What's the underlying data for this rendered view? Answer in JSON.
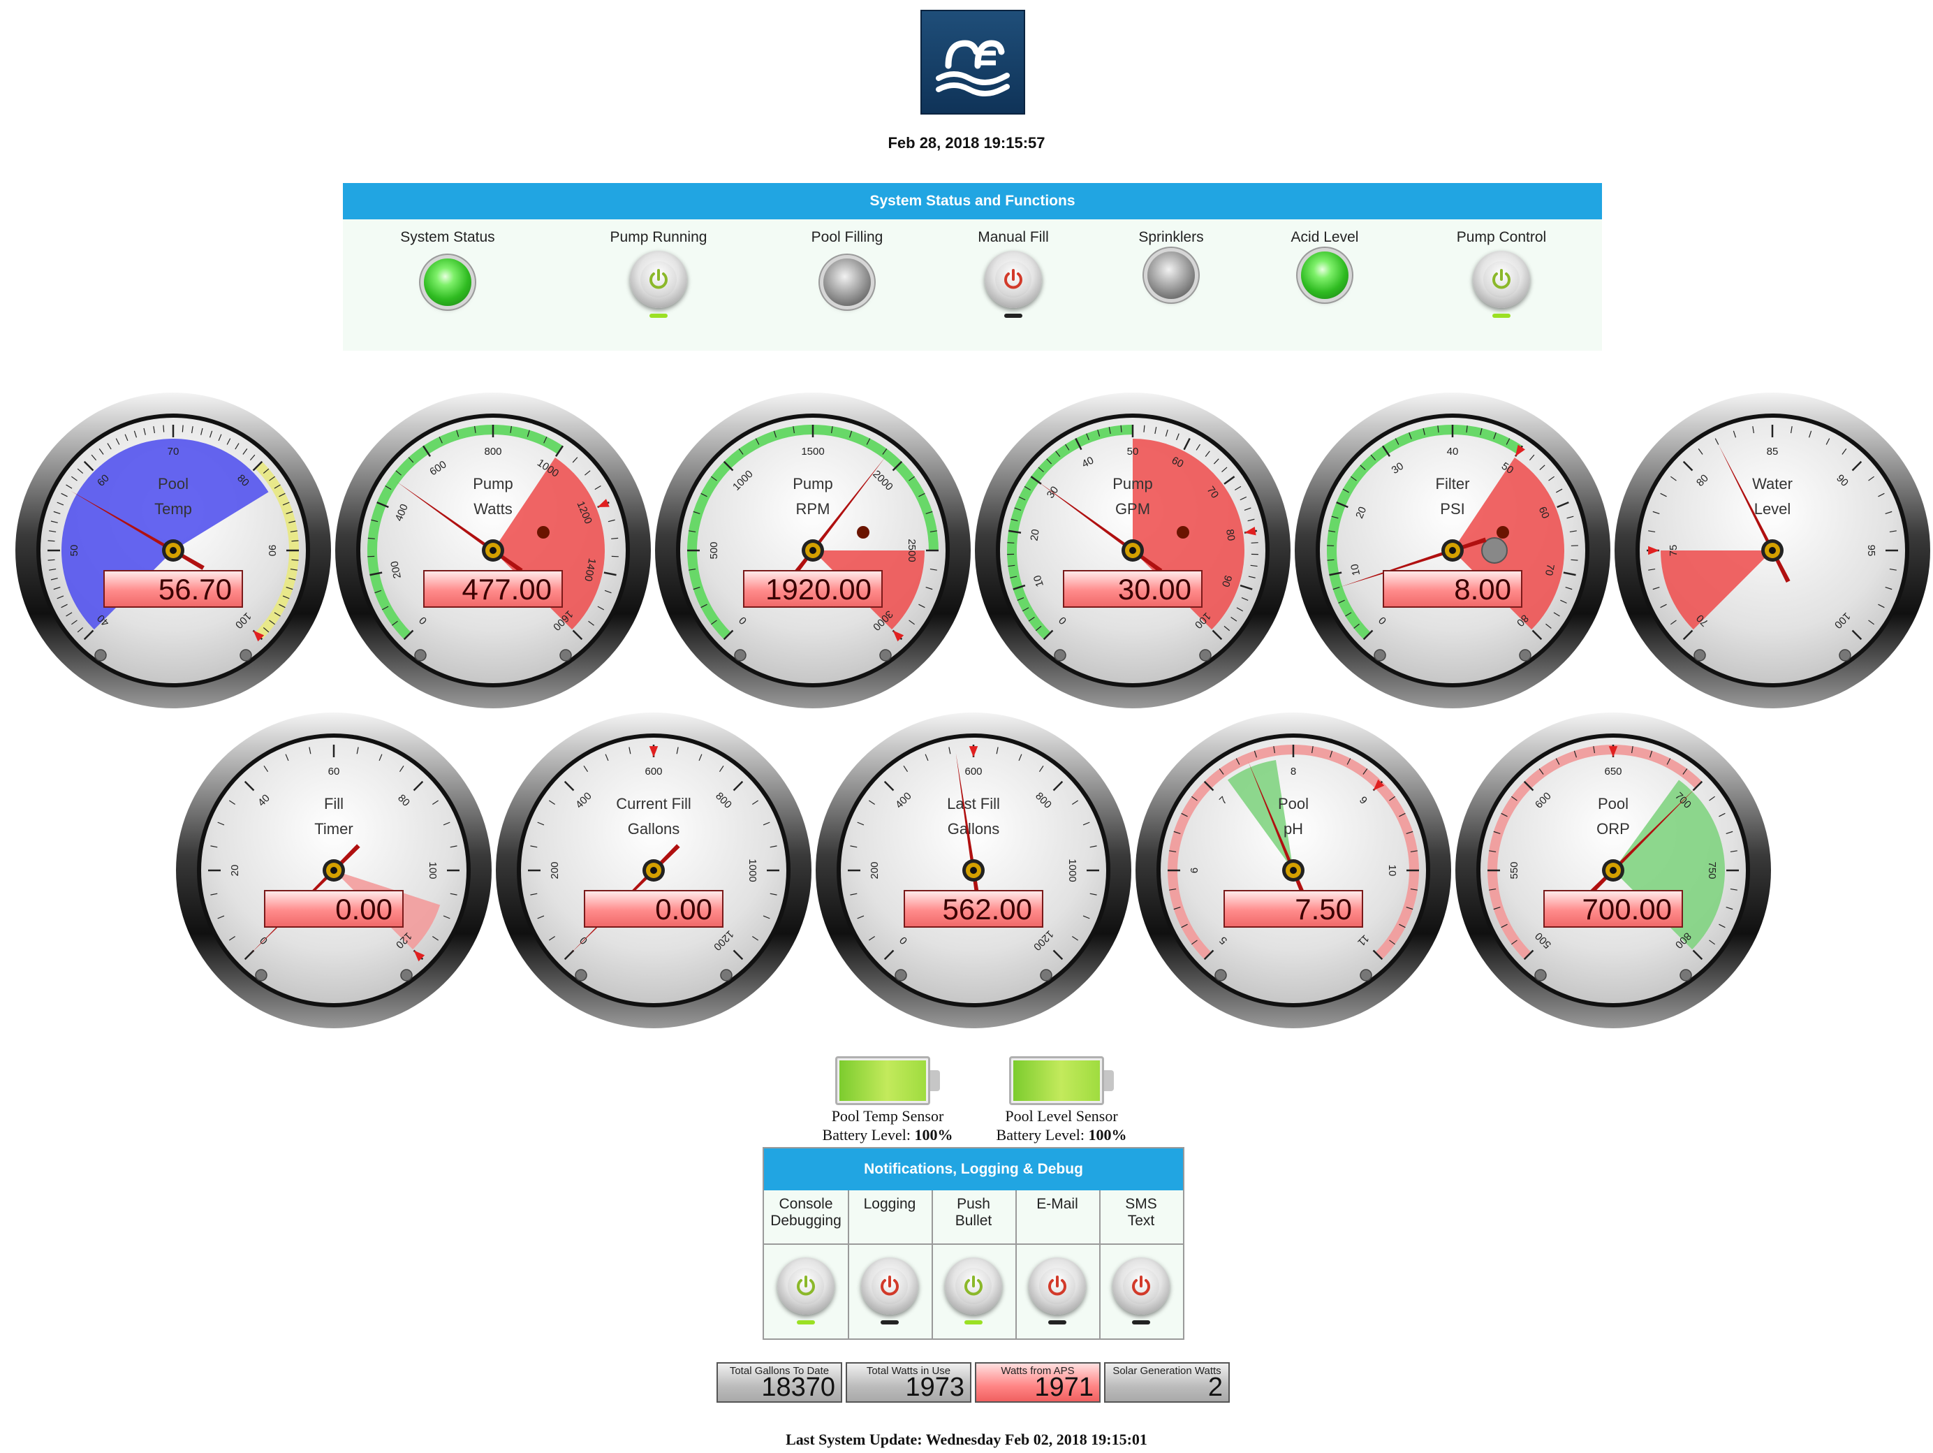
{
  "header": {
    "timestamp": "Feb 28, 2018 19:15:57"
  },
  "status_panel": {
    "title": "System Status and Functions",
    "items": [
      {
        "label": "System Status",
        "kind": "led",
        "state": "green"
      },
      {
        "label": "Pump Running",
        "kind": "power",
        "icon_color": "#8bb82a",
        "indicator": "on"
      },
      {
        "label": "Pool Filling",
        "kind": "led",
        "state": "gray"
      },
      {
        "label": "Manual Fill",
        "kind": "power",
        "icon_color": "#d23a2a",
        "indicator": "off"
      },
      {
        "label": "Sprinklers",
        "kind": "led",
        "state": "gray"
      },
      {
        "label": "Acid Level",
        "kind": "led",
        "state": "green"
      },
      {
        "label": "Pump Control",
        "kind": "power",
        "icon_color": "#8bb82a",
        "indicator": "on"
      }
    ]
  },
  "gauges": [
    {
      "id": "pool-temp",
      "title1": "Pool",
      "title2": "Temp",
      "min": 40,
      "max": 100,
      "major": 10,
      "minor": 1,
      "value": 56.7,
      "display": "56.70",
      "labels": [
        "40",
        "50",
        "60",
        "70",
        "80",
        "90",
        "100"
      ],
      "sections": [
        {
          "from": 40,
          "to": 83,
          "color": "#5050ee"
        }
      ],
      "bands": [
        {
          "from": 80,
          "to": 100,
          "color": "#e8e88a"
        }
      ],
      "marker": 100
    },
    {
      "id": "pump-watts",
      "title1": "Pump",
      "title2": "Watts",
      "min": 0,
      "max": 1600,
      "major": 200,
      "minor": 50,
      "value": 477,
      "display": "477.00",
      "labels": [
        "0",
        "200",
        "400",
        "600",
        "800",
        "1000",
        "1200",
        "1400",
        "1600"
      ],
      "sections": [
        {
          "from": 1000,
          "to": 1600,
          "color": "#ee5050"
        }
      ],
      "bands": [
        {
          "from": 0,
          "to": 1000,
          "color": "#68d868"
        }
      ],
      "marker": 1200,
      "led": true
    },
    {
      "id": "pump-rpm",
      "title1": "Pump",
      "title2": "RPM",
      "min": 0,
      "max": 3000,
      "major": 500,
      "minor": 100,
      "value": 1920,
      "display": "1920.00",
      "labels": [
        "0",
        "500",
        "1000",
        "1500",
        "2000",
        "2500",
        "3000"
      ],
      "sections": [
        {
          "from": 2500,
          "to": 3000,
          "color": "#ee5050"
        }
      ],
      "bands": [
        {
          "from": 0,
          "to": 2500,
          "color": "#68d868"
        }
      ],
      "marker": 3000,
      "led": true
    },
    {
      "id": "pump-gpm",
      "title1": "Pump",
      "title2": "GPM",
      "min": 0,
      "max": 100,
      "major": 10,
      "minor": 2,
      "value": 30,
      "display": "30.00",
      "labels": [
        "0",
        "10",
        "20",
        "30",
        "40",
        "50",
        "60",
        "70",
        "80",
        "90",
        "100"
      ],
      "sections": [
        {
          "from": 50,
          "to": 100,
          "color": "#ee5050"
        }
      ],
      "bands": [
        {
          "from": 0,
          "to": 50,
          "color": "#68d868"
        }
      ],
      "marker": 80,
      "led": true
    },
    {
      "id": "filter-psi",
      "title1": "Filter",
      "title2": "PSI",
      "min": 0,
      "max": 80,
      "major": 10,
      "minor": 2,
      "value": 8,
      "display": "8.00",
      "labels": [
        "0",
        "10",
        "20",
        "30",
        "40",
        "50",
        "60",
        "70",
        "80"
      ],
      "sections": [
        {
          "from": 50,
          "to": 80,
          "color": "#ee5050"
        }
      ],
      "bands": [
        {
          "from": 0,
          "to": 50,
          "color": "#68d868"
        }
      ],
      "marker": 50,
      "led": true,
      "knob": true
    },
    {
      "id": "water-level",
      "title1": "Water",
      "title2": "Level",
      "min": 70,
      "max": 100,
      "major": 5,
      "minor": 1,
      "value": 82,
      "display": "",
      "labels": [
        "70",
        "75",
        "80",
        "85",
        "90",
        "95",
        "100"
      ],
      "sections": [
        {
          "from": 70,
          "to": 75,
          "color": "#ee5050"
        }
      ],
      "bands": [],
      "marker": 75
    },
    {
      "id": "fill-timer",
      "title1": "Fill",
      "title2": "Timer",
      "min": 0,
      "max": 120,
      "major": 20,
      "minor": 5,
      "value": 0,
      "display": "0.00",
      "labels": [
        "0",
        "20",
        "40",
        "60",
        "80",
        "100",
        "120"
      ],
      "sections": [
        {
          "from": 108,
          "to": 120,
          "color": "#f39a9a"
        }
      ],
      "bands": [],
      "marker": 120
    },
    {
      "id": "current-fill",
      "title1": "Current Fill",
      "title2": "Gallons",
      "min": 0,
      "max": 1200,
      "major": 200,
      "minor": 50,
      "value": 0,
      "display": "0.00",
      "labels": [
        "0",
        "200",
        "400",
        "600",
        "800",
        "1000",
        "1200"
      ],
      "sections": [],
      "bands": [],
      "marker": 600
    },
    {
      "id": "last-fill",
      "title1": "Last Fill",
      "title2": "Gallons",
      "min": 0,
      "max": 1200,
      "major": 200,
      "minor": 50,
      "value": 562,
      "display": "562.00",
      "labels": [
        "0",
        "200",
        "400",
        "600",
        "800",
        "1000",
        "1200"
      ],
      "sections": [],
      "bands": [],
      "marker": 600
    },
    {
      "id": "pool-ph",
      "title1": "Pool",
      "title2": "pH",
      "min": 5,
      "max": 11,
      "major": 1,
      "minor": 0.2,
      "value": 7.5,
      "display": "7.50",
      "labels": [
        "5",
        "6",
        "7",
        "8",
        "9",
        "10",
        "11"
      ],
      "sections": [
        {
          "from": 7.2,
          "to": 7.8,
          "color": "#7ed37e"
        }
      ],
      "bands": [
        {
          "from": 5,
          "to": 11,
          "color": "#f0a0a0"
        }
      ],
      "marker": 9
    },
    {
      "id": "pool-orp",
      "title1": "Pool",
      "title2": "ORP",
      "min": 500,
      "max": 800,
      "major": 50,
      "minor": 10,
      "value": 700,
      "display": "700.00",
      "labels": [
        "500",
        "550",
        "600",
        "650",
        "700",
        "750",
        "800"
      ],
      "sections": [
        {
          "from": 690,
          "to": 800,
          "color": "#7ed37e"
        }
      ],
      "bands": [
        {
          "from": 500,
          "to": 700,
          "color": "#f0a0a0"
        }
      ],
      "marker": 650
    }
  ],
  "batteries": [
    {
      "label": "Pool Temp Sensor",
      "level_prefix": "Battery Level:",
      "level": "100%"
    },
    {
      "label": "Pool Level Sensor",
      "level_prefix": "Battery Level:",
      "level": "100%"
    }
  ],
  "notifications": {
    "title": "Notifications, Logging & Debug",
    "items": [
      {
        "line1": "Console",
        "line2": "Debugging",
        "icon_color": "#8bb82a",
        "indicator": "on"
      },
      {
        "line1": "Logging",
        "line2": "",
        "icon_color": "#d23a2a",
        "indicator": "off"
      },
      {
        "line1": "Push",
        "line2": "Bullet",
        "icon_color": "#8bb82a",
        "indicator": "on"
      },
      {
        "line1": "E-Mail",
        "line2": "",
        "icon_color": "#d23a2a",
        "indicator": "off"
      },
      {
        "line1": "SMS",
        "line2": "Text",
        "icon_color": "#d23a2a",
        "indicator": "off"
      }
    ]
  },
  "stats": [
    {
      "label": "Total Gallons To Date",
      "value": "18370",
      "style": "gray"
    },
    {
      "label": "Total Watts in Use",
      "value": "1973",
      "style": "gray"
    },
    {
      "label": "Watts from APS",
      "value": "1971",
      "style": "red"
    },
    {
      "label": "Solar Generation Watts",
      "value": "2",
      "style": "gray"
    }
  ],
  "footer": {
    "last_update": "Last System Update: Wednesday Feb 02, 2018 19:15:01"
  },
  "colors": {
    "accent": "#21a5e2",
    "panel_bg": "#f3fbf5"
  }
}
